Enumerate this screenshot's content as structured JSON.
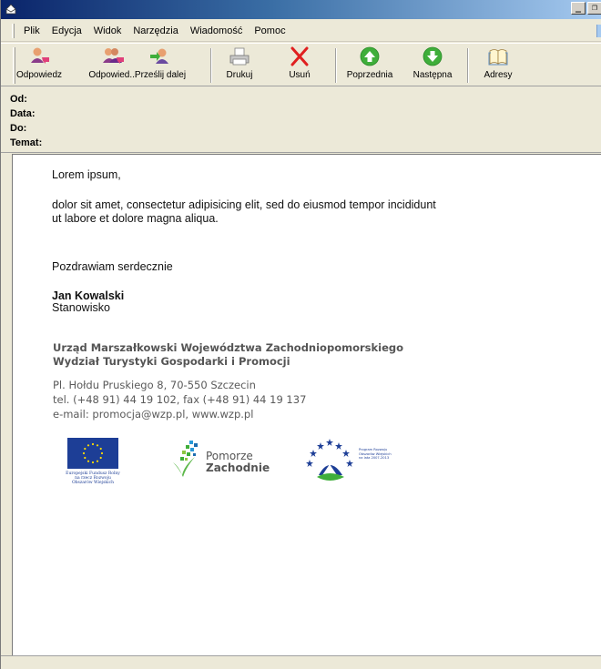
{
  "menu": [
    "Plik",
    "Edycja",
    "Widok",
    "Narzędzia",
    "Wiadomość",
    "Pomoc"
  ],
  "toolbar": {
    "reply": "Odpowiedz",
    "reply_all": "Odpowied...",
    "forward": "Prześlij dalej",
    "print": "Drukuj",
    "delete": "Usuń",
    "previous": "Poprzednia",
    "next": "Następna",
    "addresses": "Adresy"
  },
  "headers": {
    "from": "Od:",
    "date": "Data:",
    "to": "Do:",
    "subject": "Temat:"
  },
  "message": {
    "greeting": "Lorem ipsum,",
    "line1": "dolor sit amet, consectetur adipisicing elit, sed do eiusmod tempor incididunt",
    "line2": "ut labore et dolore magna aliqua.",
    "closing": "Pozdrawiam serdecznie",
    "sender_name": "Jan Kowalski",
    "sender_position": "Stanowisko"
  },
  "signature": {
    "office_line1": "Urząd Marszałkowski Województwa Zachodniopomorskiego",
    "office_line2": "Wydział Turystyki Gospodarki i Promocji",
    "address": "Pl. Hołdu Pruskiego 8, 70-550 Szczecin",
    "phone": "tel. (+48 91) 44 19 102, fax (+48 91) 44 19 137",
    "email": "e-mail: promocja@wzp.pl, www.wzp.pl"
  },
  "logos": {
    "eu_caption": "Europejski Fundusz Rolny na rzecz Rozwoju Obszarów Wiejskich",
    "pz_line1": "Pomorze",
    "pz_line2": "Zachodnie",
    "prow_text": "Program Rozwoju Obszarów Wiejskich na lata 2007-2013"
  },
  "colors": {
    "titlebar_start": "#0a246a",
    "titlebar_end": "#a6caf0",
    "window_bg": "#ece9d8",
    "eu_blue": "#1d3e96",
    "delete_red": "#e02020",
    "nav_green": "#3fae3a"
  },
  "icons": {
    "reply": "reply-icon",
    "reply_all": "reply-all-icon",
    "forward": "forward-icon",
    "print": "printer-icon",
    "delete": "delete-x-icon",
    "previous": "arrow-up-icon",
    "next": "arrow-down-icon",
    "addresses": "address-book-icon"
  }
}
